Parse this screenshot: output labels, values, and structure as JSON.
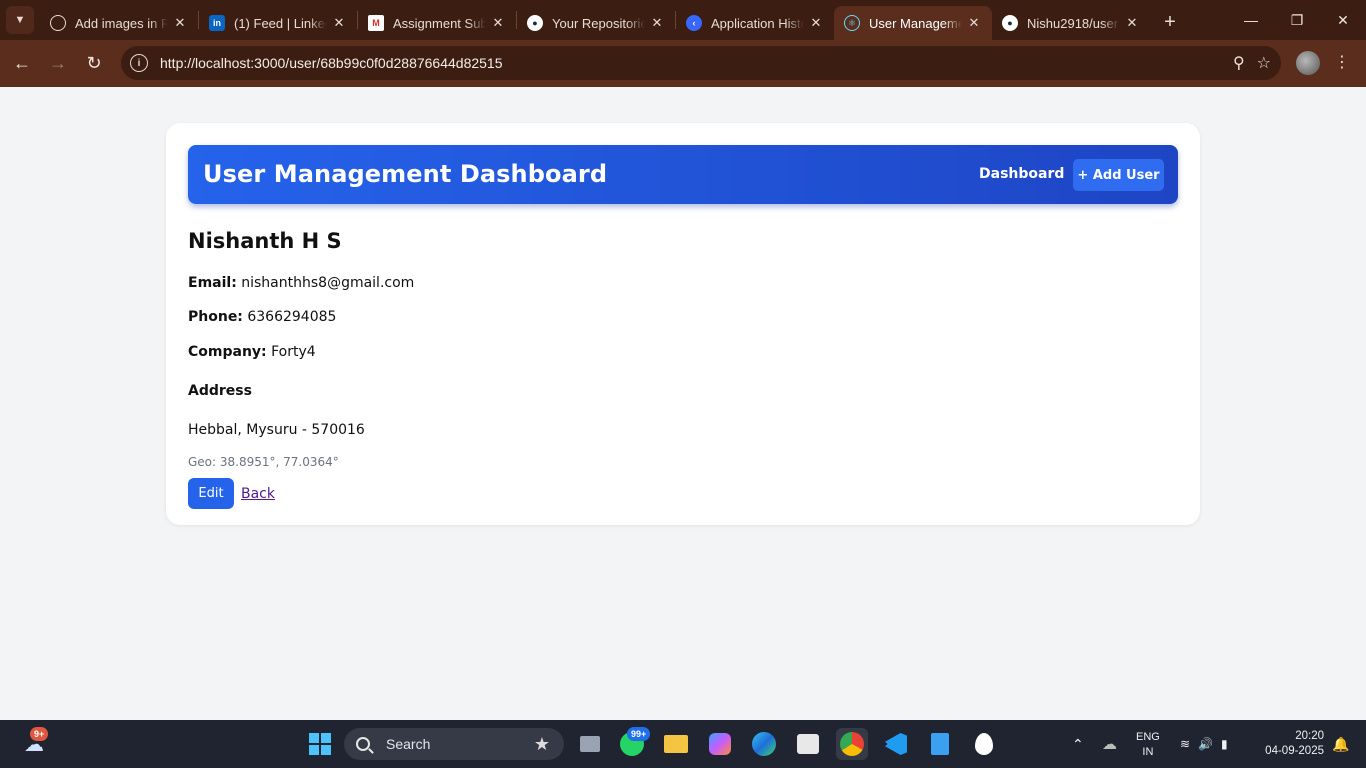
{
  "browser": {
    "tabs": [
      {
        "title": "Add images in R",
        "icon": "openai-icon",
        "active": false
      },
      {
        "title": "(1) Feed | LinkedIn",
        "icon": "linkedin-icon",
        "active": false
      },
      {
        "title": "Assignment Subm",
        "icon": "gmail-icon",
        "active": false
      },
      {
        "title": "Your Repositories",
        "icon": "github-icon",
        "active": false
      },
      {
        "title": "Application Histo",
        "icon": "app-history-icon",
        "active": false
      },
      {
        "title": "User Manageme",
        "icon": "react-icon",
        "active": true
      },
      {
        "title": "Nishu2918/user",
        "icon": "github-icon",
        "active": false
      }
    ],
    "url": "http://localhost:3000/user/68b99c0f0d28876644d82515"
  },
  "app": {
    "brand": "User Management Dashboard",
    "nav_dashboard": "Dashboard",
    "add_user_label": "+ Add User"
  },
  "user": {
    "name": "Nishanth H S",
    "email_label": "Email:",
    "email": "nishanthhs8@gmail.com",
    "phone_label": "Phone:",
    "phone": "6366294085",
    "company_label": "Company:",
    "company": "Forty4",
    "address_heading": "Address",
    "address_line": "Hebbal, Mysuru - 570016",
    "geo": "Geo: 38.8951°, 77.0364°"
  },
  "actions": {
    "edit_label": "Edit",
    "back_label": "Back"
  },
  "taskbar": {
    "weather_badge": "9+",
    "search_label": "Search",
    "whatsapp_badge": "99+",
    "lang_line1": "ENG",
    "lang_line2": "IN",
    "time": "20:20",
    "date": "04-09-2025"
  },
  "colors": {
    "brand_blue": "#2563eb",
    "chrome_dark": "#3b1d12",
    "chrome_toolbar": "#5a2d1d"
  }
}
